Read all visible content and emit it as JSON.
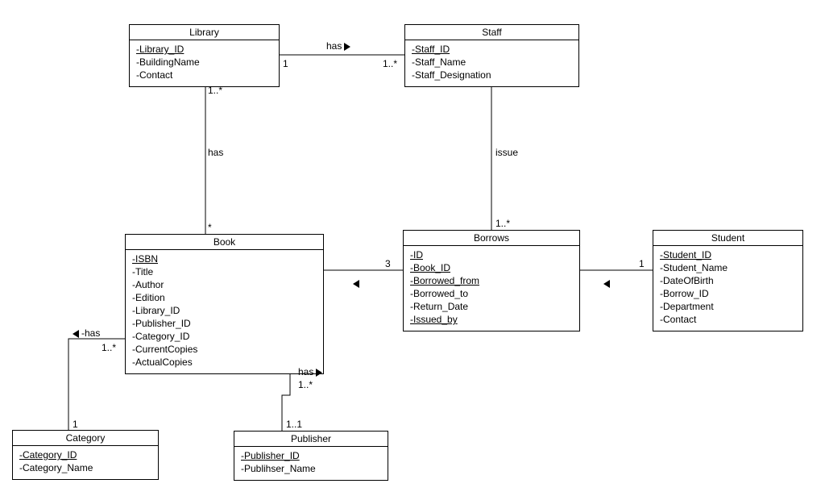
{
  "classes": {
    "library": {
      "name": "Library",
      "attrs": [
        "-Library_ID",
        "-BuildingName",
        "-Contact"
      ]
    },
    "staff": {
      "name": "Staff",
      "attrs": [
        "-Staff_ID",
        "-Staff_Name",
        "-Staff_Designation"
      ]
    },
    "book": {
      "name": "Book",
      "attrs": [
        "-ISBN",
        "-Title",
        "-Author",
        "-Edition",
        "-Library_ID",
        "-Publisher_ID",
        "-Category_ID",
        "-CurrentCopies",
        "-ActualCopies"
      ]
    },
    "borrows": {
      "name": "Borrows",
      "attrs": [
        "-ID",
        "-Book_ID",
        "-Borrowed_from",
        "-Borrowed_to",
        "-Return_Date",
        "-Issued_by"
      ]
    },
    "student": {
      "name": "Student",
      "attrs": [
        "-Student_ID",
        "-Student_Name",
        "-DateOfBirth",
        "-Borrow_ID",
        "-Department",
        "-Contact"
      ]
    },
    "category": {
      "name": "Category",
      "attrs": [
        "-Category_ID",
        "-Category_Name"
      ]
    },
    "publisher": {
      "name": "Publisher",
      "attrs": [
        "-Publisher_ID",
        "-Publihser_Name"
      ]
    }
  },
  "assoc": {
    "library_staff": {
      "label": "has",
      "m1": "1",
      "m2": "1..*"
    },
    "library_book": {
      "label": "has",
      "m1": "1..*",
      "m2": "*"
    },
    "staff_borrows": {
      "label": "issue",
      "m2": "1..*"
    },
    "book_borrows": {
      "m2": "3"
    },
    "borrows_student": {
      "m2": "1"
    },
    "book_category": {
      "label": "-has",
      "m1": "1..*",
      "m2": "1"
    },
    "book_publisher": {
      "label": "has",
      "m1": "1..*",
      "m2": "1..1"
    }
  }
}
